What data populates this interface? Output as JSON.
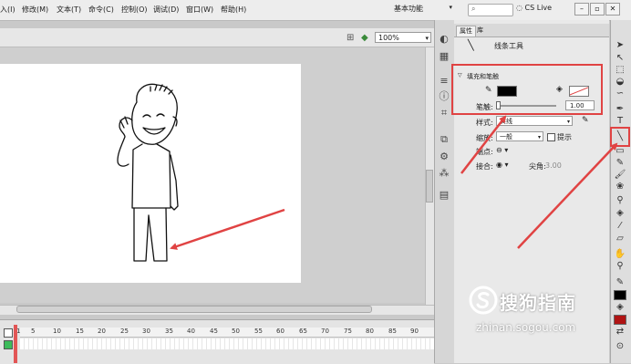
{
  "menubar": {
    "items": [
      "入(I)",
      "修改(M)",
      "文本(T)",
      "命令(C)",
      "控制(O)",
      "调试(D)",
      "窗口(W)",
      "帮助(H)"
    ],
    "workspace": "基本功能",
    "cs_live": "CS Live"
  },
  "stage": {
    "zoom": "100%"
  },
  "timeline": {
    "frame_numbers": [
      "1",
      "5",
      "10",
      "15",
      "20",
      "25",
      "30",
      "35",
      "40",
      "45",
      "50",
      "55",
      "60",
      "65",
      "70",
      "75",
      "80",
      "85",
      "90"
    ]
  },
  "properties": {
    "tabs": [
      "属性",
      "库"
    ],
    "tool_name": "线条工具",
    "section_fill_stroke": "填充和笔触",
    "stroke_label": "笔触:",
    "stroke_width": "1.00",
    "style_label": "样式:",
    "style_value": "实线",
    "scale_label": "缩放:",
    "scale_value": "一般",
    "hint_label": "提示",
    "cap_label": "端点:",
    "join_label": "接合:",
    "miter_label": "尖角:",
    "miter_value": "3.00"
  },
  "colors": {
    "highlight": "#e04343",
    "stroke_color": "#000000",
    "tool_fill_color": "#b01414"
  },
  "watermark": {
    "title": "搜狗指南",
    "url": "zhinan.sogou.com"
  }
}
